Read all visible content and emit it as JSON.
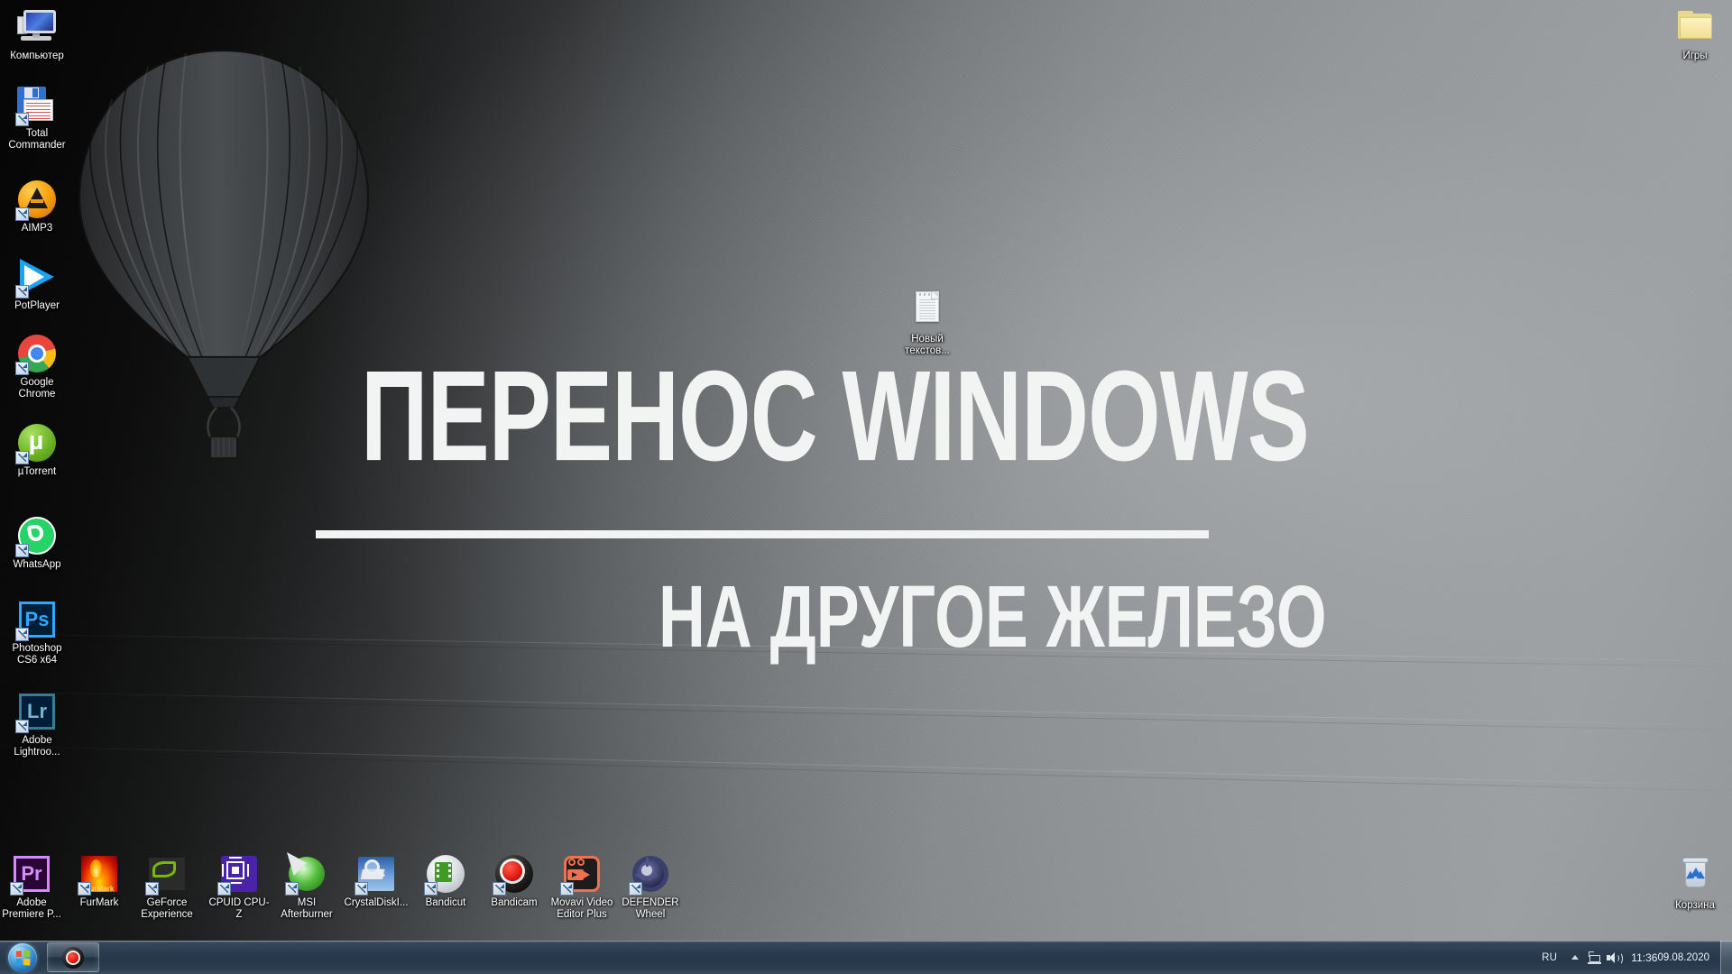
{
  "desktop": {
    "wallpaper_name": "hot-air-balloon-grey-stucco",
    "colors": {
      "wallpaper_dark": "#050505",
      "wallpaper_light": "#a2a5a8",
      "title_text": "#f2f3f3",
      "gold_accent": "#b3a63a",
      "taskbar_top": "#49596a",
      "taskbar_bottom": "#2c3e50"
    }
  },
  "overlay_title": {
    "main": "ПЕРЕНОС WINDOWS",
    "subtitle": "НА ДРУГОЕ ЖЕЛЕЗО"
  },
  "icons_left_column": [
    {
      "label": "Компьютер",
      "icon": "computer-icon",
      "shortcut": false
    },
    {
      "label": "Total Commander",
      "icon": "total-commander-icon",
      "shortcut": true
    },
    {
      "label": "AIMP3",
      "icon": "aimp3-icon",
      "shortcut": true
    },
    {
      "label": "PotPlayer",
      "icon": "potplayer-icon",
      "shortcut": true
    },
    {
      "label": "Google Chrome",
      "icon": "google-chrome-icon",
      "shortcut": true
    },
    {
      "label": "µTorrent",
      "icon": "utorrent-icon",
      "shortcut": true
    },
    {
      "label": "WhatsApp",
      "icon": "whatsapp-icon",
      "shortcut": true
    },
    {
      "label": "Photoshop CS6 x64",
      "icon": "photoshop-icon",
      "shortcut": true
    },
    {
      "label": "Adobe Lightroo...",
      "icon": "lightroom-icon",
      "shortcut": true
    }
  ],
  "icons_bottom_row": [
    {
      "label": "Adobe Premiere P...",
      "icon": "premiere-pro-icon",
      "shortcut": true
    },
    {
      "label": "FurMark",
      "icon": "furmark-icon",
      "shortcut": true
    },
    {
      "label": "GeForce Experience",
      "icon": "geforce-experience-icon",
      "shortcut": true
    },
    {
      "label": "CPUID CPU-Z",
      "icon": "cpu-z-icon",
      "shortcut": true
    },
    {
      "label": "MSI Afterburner",
      "icon": "msi-afterburner-icon",
      "shortcut": true
    },
    {
      "label": "CrystalDiskI...",
      "icon": "crystaldiskinfo-icon",
      "shortcut": true
    },
    {
      "label": "Bandicut",
      "icon": "bandicut-icon",
      "shortcut": true
    },
    {
      "label": "Bandicam",
      "icon": "bandicam-icon",
      "shortcut": true
    },
    {
      "label": "Movavi Video Editor Plus",
      "icon": "movavi-icon",
      "shortcut": true
    },
    {
      "label": "DEFENDER Wheel",
      "icon": "defender-wheel-icon",
      "shortcut": true
    }
  ],
  "icons_other": [
    {
      "label": "Новый текстов...",
      "icon": "text-document-icon",
      "shortcut": false
    },
    {
      "label": "Игры",
      "icon": "folder-icon",
      "shortcut": false
    },
    {
      "label": "Корзина",
      "icon": "recycle-bin-icon",
      "shortcut": false
    }
  ],
  "taskbar": {
    "start_button_label": "Start",
    "running_apps": [
      {
        "label": "Bandicam",
        "icon": "bandicam-icon",
        "active": true
      }
    ],
    "tray": {
      "language": "RU",
      "show_hidden_label": "Отображать скрытые значки",
      "network_icon": "network-icon",
      "volume_icon": "volume-icon",
      "time": "11:36",
      "date": "09.08.2020"
    }
  }
}
